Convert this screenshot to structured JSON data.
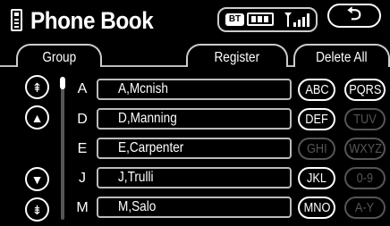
{
  "header": {
    "title": "Phone Book",
    "bt_label": "BT",
    "back_glyph": "⮌"
  },
  "tabs": {
    "group": "Group",
    "register": "Register",
    "delete_all": "Delete All"
  },
  "scroll": {
    "top_glyph": "⇞",
    "up_glyph": "▲",
    "down_glyph": "▼",
    "bottom_glyph": "⇟"
  },
  "entries": [
    {
      "letter": "A",
      "name": "A,Mcnish"
    },
    {
      "letter": "D",
      "name": "D,Manning"
    },
    {
      "letter": "E",
      "name": "E,Carpenter"
    },
    {
      "letter": "J",
      "name": "J,Trulli"
    },
    {
      "letter": "M",
      "name": "M,Salo"
    }
  ],
  "index_buttons": [
    {
      "label": "ABC",
      "enabled": true
    },
    {
      "label": "PQRS",
      "enabled": true
    },
    {
      "label": "DEF",
      "enabled": true
    },
    {
      "label": "TUV",
      "enabled": false
    },
    {
      "label": "GHI",
      "enabled": false
    },
    {
      "label": "WXYZ",
      "enabled": false
    },
    {
      "label": "JKL",
      "enabled": true
    },
    {
      "label": "0-9",
      "enabled": false
    },
    {
      "label": "MNO",
      "enabled": true
    },
    {
      "label": "A-Y",
      "enabled": false
    }
  ],
  "colors": {
    "background": "#000000",
    "foreground": "#ffffff",
    "disabled": "#555555"
  }
}
